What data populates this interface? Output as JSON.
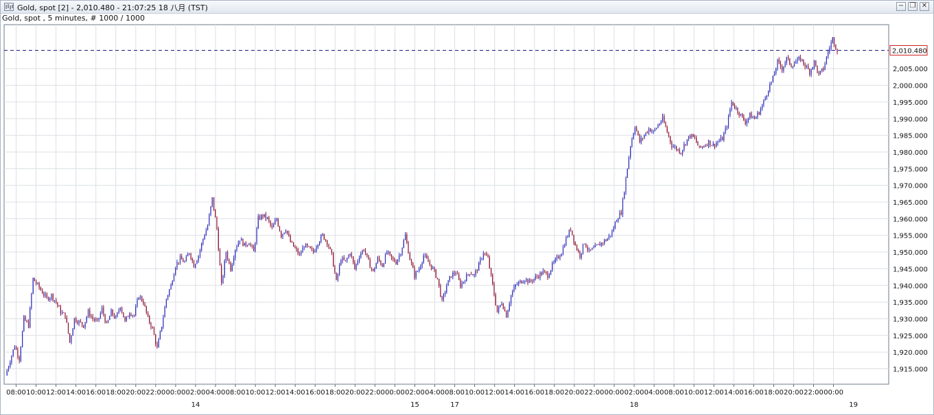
{
  "window": {
    "title": "Gold, spot [2] - 2,010.480 - 21:07:25  18 八月 (TST)",
    "subtitle": "Gold, spot , 5 minutes, # 1000 / 1000",
    "buttons": [
      "minimize",
      "restore",
      "close"
    ],
    "button_glyphs": [
      "−",
      "❐",
      "✕"
    ]
  },
  "colors": {
    "up_candle": "#2a2ab8",
    "down_candle": "#8a1030",
    "price_line": "#1a1a80",
    "last_price_box": "#cc2222"
  },
  "chart_data": {
    "type": "candlestick",
    "interval": "5 minutes",
    "y_range": [
      1910,
      2014
    ],
    "y_ticks": [
      "1,915.000",
      "1,920.000",
      "1,925.000",
      "1,930.000",
      "1,935.000",
      "1,940.000",
      "1,945.000",
      "1,950.000",
      "1,955.000",
      "1,960.000",
      "1,965.000",
      "1,970.000",
      "1,975.000",
      "1,980.000",
      "1,985.000",
      "1,990.000",
      "1,995.000",
      "2,000.000",
      "2,005.000"
    ],
    "y_tick_values": [
      1915,
      1920,
      1925,
      1930,
      1935,
      1940,
      1945,
      1950,
      1955,
      1960,
      1965,
      1970,
      1975,
      1980,
      1985,
      1990,
      1995,
      2000,
      2005
    ],
    "last_price": 2010.48,
    "last_price_label": "2,010.480",
    "grid": true,
    "time_ticks": [
      "08:00",
      "10:00",
      "12:00",
      "14:00",
      "16:00",
      "18:00",
      "20:00",
      "22:00",
      "00:00",
      "02:00",
      "04:00",
      "08:00",
      "10:00",
      "12:00",
      "14:00",
      "16:00",
      "18:00",
      "20:00",
      "22:00",
      "00:00",
      "02:00",
      "04:00",
      "08:00",
      "10:00",
      "12:00",
      "14:00",
      "16:00",
      "18:00",
      "20:00",
      "22:00",
      "00:00",
      "02:00",
      "04:00",
      "08:00",
      "10:00",
      "12:00",
      "14:00",
      "16:00",
      "18:00",
      "20:00",
      "22:00",
      "00:00"
    ],
    "date_labels": [
      {
        "label": "14",
        "tick_index": 9
      },
      {
        "label": "15",
        "tick_index": 20
      },
      {
        "label": "17",
        "tick_index": 22
      },
      {
        "label": "18",
        "tick_index": 31
      },
      {
        "label": "19",
        "tick_index": 42
      }
    ],
    "price_path": [
      [
        0,
        1913
      ],
      [
        2,
        1922
      ],
      [
        3,
        1918
      ],
      [
        4,
        1930
      ],
      [
        5,
        1928
      ],
      [
        6,
        1942
      ],
      [
        7,
        1940
      ],
      [
        8,
        1938
      ],
      [
        9,
        1936
      ],
      [
        10,
        1937
      ],
      [
        11,
        1935
      ],
      [
        12,
        1932
      ],
      [
        13,
        1931
      ],
      [
        14,
        1923
      ],
      [
        15,
        1930
      ],
      [
        16,
        1929
      ],
      [
        17,
        1928
      ],
      [
        18,
        1932
      ],
      [
        19,
        1930
      ],
      [
        20,
        1929
      ],
      [
        21,
        1933
      ],
      [
        22,
        1928
      ],
      [
        23,
        1932
      ],
      [
        24,
        1930
      ],
      [
        25,
        1934
      ],
      [
        26,
        1929
      ],
      [
        27,
        1932
      ],
      [
        28,
        1931
      ],
      [
        29,
        1937
      ],
      [
        30,
        1935
      ],
      [
        31,
        1930
      ],
      [
        32,
        1927
      ],
      [
        33,
        1921
      ],
      [
        34,
        1928
      ],
      [
        35,
        1936
      ],
      [
        36,
        1940
      ],
      [
        37,
        1946
      ],
      [
        38,
        1948
      ],
      [
        39,
        1947
      ],
      [
        40,
        1950
      ],
      [
        41,
        1946
      ],
      [
        42,
        1949
      ],
      [
        43,
        1954
      ],
      [
        44,
        1958
      ],
      [
        45,
        1966
      ],
      [
        46,
        1957
      ],
      [
        47,
        1940
      ],
      [
        48,
        1950
      ],
      [
        49,
        1945
      ],
      [
        50,
        1951
      ],
      [
        51,
        1954
      ],
      [
        52,
        1952
      ],
      [
        53,
        1953
      ],
      [
        54,
        1950
      ],
      [
        55,
        1960
      ],
      [
        56,
        1961
      ],
      [
        57,
        1960
      ],
      [
        58,
        1957
      ],
      [
        59,
        1960
      ],
      [
        60,
        1955
      ],
      [
        61,
        1957
      ],
      [
        62,
        1953
      ],
      [
        63,
        1951
      ],
      [
        64,
        1949
      ],
      [
        65,
        1952
      ],
      [
        66,
        1951
      ],
      [
        67,
        1950
      ],
      [
        68,
        1953
      ],
      [
        69,
        1955
      ],
      [
        70,
        1953
      ],
      [
        71,
        1949
      ],
      [
        72,
        1941
      ],
      [
        73,
        1948
      ],
      [
        74,
        1947
      ],
      [
        75,
        1950
      ],
      [
        76,
        1945
      ],
      [
        77,
        1949
      ],
      [
        78,
        1951
      ],
      [
        79,
        1947
      ],
      [
        80,
        1944
      ],
      [
        81,
        1948
      ],
      [
        82,
        1946
      ],
      [
        83,
        1950
      ],
      [
        84,
        1948
      ],
      [
        85,
        1947
      ],
      [
        86,
        1950
      ],
      [
        87,
        1955
      ],
      [
        88,
        1948
      ],
      [
        89,
        1943
      ],
      [
        90,
        1945
      ],
      [
        91,
        1949
      ],
      [
        92,
        1947
      ],
      [
        93,
        1945
      ],
      [
        94,
        1942
      ],
      [
        95,
        1935
      ],
      [
        96,
        1940
      ],
      [
        97,
        1943
      ],
      [
        98,
        1944
      ],
      [
        99,
        1940
      ],
      [
        100,
        1942
      ],
      [
        101,
        1944
      ],
      [
        102,
        1943
      ],
      [
        103,
        1946
      ],
      [
        104,
        1950
      ],
      [
        105,
        1948
      ],
      [
        106,
        1940
      ],
      [
        107,
        1932
      ],
      [
        108,
        1935
      ],
      [
        109,
        1931
      ],
      [
        110,
        1937
      ],
      [
        111,
        1940
      ],
      [
        112,
        1941
      ],
      [
        113,
        1942
      ],
      [
        114,
        1941
      ],
      [
        115,
        1942
      ],
      [
        116,
        1943
      ],
      [
        117,
        1944
      ],
      [
        118,
        1943
      ],
      [
        119,
        1946
      ],
      [
        120,
        1948
      ],
      [
        121,
        1950
      ],
      [
        122,
        1954
      ],
      [
        123,
        1957
      ],
      [
        124,
        1952
      ],
      [
        125,
        1949
      ],
      [
        126,
        1953
      ],
      [
        127,
        1950
      ],
      [
        128,
        1951
      ],
      [
        129,
        1952
      ],
      [
        130,
        1953
      ],
      [
        131,
        1954
      ],
      [
        132,
        1956
      ],
      [
        133,
        1960
      ],
      [
        134,
        1962
      ],
      [
        135,
        1972
      ],
      [
        136,
        1982
      ],
      [
        137,
        1988
      ],
      [
        138,
        1983
      ],
      [
        139,
        1985
      ],
      [
        140,
        1987
      ],
      [
        141,
        1986
      ],
      [
        142,
        1988
      ],
      [
        143,
        1990
      ],
      [
        144,
        1986
      ],
      [
        145,
        1982
      ],
      [
        146,
        1981
      ],
      [
        147,
        1980
      ],
      [
        148,
        1983
      ],
      [
        149,
        1985
      ],
      [
        150,
        1984
      ],
      [
        151,
        1981
      ],
      [
        152,
        1982
      ],
      [
        153,
        1983
      ],
      [
        154,
        1982
      ],
      [
        155,
        1983
      ],
      [
        156,
        1984
      ],
      [
        157,
        1988
      ],
      [
        158,
        1995
      ],
      [
        159,
        1993
      ],
      [
        160,
        1991
      ],
      [
        161,
        1989
      ],
      [
        162,
        1991
      ],
      [
        163,
        1990
      ],
      [
        164,
        1992
      ],
      [
        165,
        1995
      ],
      [
        166,
        1999
      ],
      [
        167,
        2002
      ],
      [
        168,
        2007
      ],
      [
        169,
        2005
      ],
      [
        170,
        2008
      ],
      [
        171,
        2006
      ],
      [
        172,
        2007
      ],
      [
        173,
        2008
      ],
      [
        174,
        2006
      ],
      [
        175,
        2004
      ],
      [
        176,
        2007
      ],
      [
        177,
        2003
      ],
      [
        178,
        2005
      ],
      [
        179,
        2010
      ],
      [
        180,
        2014
      ],
      [
        181,
        2010.5
      ]
    ]
  }
}
